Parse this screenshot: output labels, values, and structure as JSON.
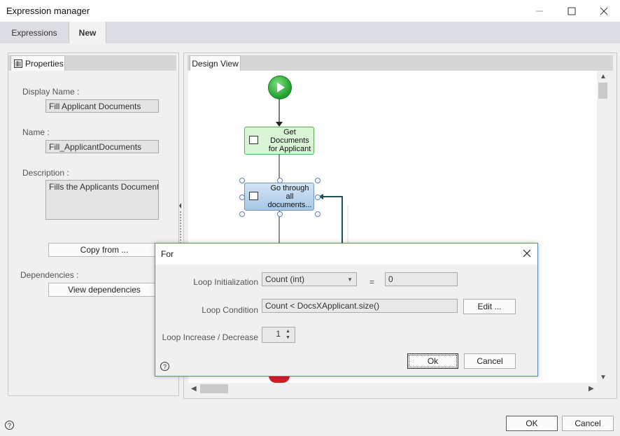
{
  "window": {
    "title": "Expression manager",
    "tabs": [
      {
        "label": "Expressions",
        "active": false
      },
      {
        "label": "New",
        "active": true
      }
    ]
  },
  "properties": {
    "tab_label": "Properties",
    "display_name_label": "Display Name :",
    "display_name_value": "Fill Applicant Documents",
    "name_label": "Name :",
    "name_value": "Fill_ApplicantDocuments",
    "description_label": "Description :",
    "description_value": "Fills the Applicants Documents",
    "copy_from_label": "Copy from ...",
    "dependencies_label": "Dependencies :",
    "view_dependencies_label": "View dependencies"
  },
  "design_view": {
    "tab_label": "Design View",
    "nodes": [
      {
        "label_lines": [
          "Get",
          "Documents",
          "for Applicant"
        ],
        "kind": "activity",
        "color": "#d9f5d5"
      },
      {
        "label_lines": [
          "Go through",
          "all",
          "documents..."
        ],
        "kind": "loop",
        "color": "#a7c6e6",
        "selected": true
      }
    ]
  },
  "dialog": {
    "title": "For",
    "loop_init_label": "Loop Initialization",
    "loop_init_type": "Count (int)",
    "equals": "=",
    "loop_init_value": "0",
    "loop_condition_label": "Loop Condition",
    "loop_condition_value": "Count < DocsXApplicant.size()",
    "edit_label": "Edit ...",
    "loop_increase_label": "Loop Increase / Decrease",
    "loop_increase_value": "1",
    "ok_label": "Ok",
    "cancel_label": "Cancel",
    "help_glyph": "?"
  },
  "footer": {
    "ok_label": "OK",
    "cancel_label": "Cancel",
    "help_glyph": "?"
  },
  "icons": {
    "minimize": "minimize-icon",
    "maximize": "maximize-icon",
    "close": "close-icon",
    "properties": "properties-grid-icon",
    "start": "play-icon"
  }
}
